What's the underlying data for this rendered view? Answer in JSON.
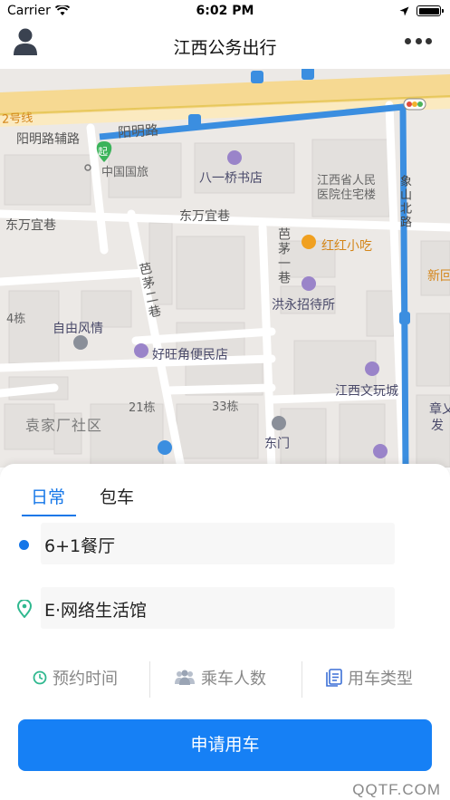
{
  "status_bar": {
    "carrier": "Carrier",
    "time": "6:02 PM"
  },
  "header": {
    "title": "江西公务出行",
    "left_icon": "user-icon",
    "right_icon": "more-icon"
  },
  "map": {
    "labels": {
      "metro_line": "2号线",
      "yangming_fulu": "阳明路辅路",
      "yangming_lu": "阳明路",
      "start_marker": "起",
      "zhongguo_guolv": "中国国旅",
      "bayiqiao_bookstore": "八一桥书店",
      "jiangxi_hospital_line1": "江西省人民",
      "jiangxi_hospital_line2": "医院住宅楼",
      "dongwan_yixiang_left": "东万宜巷",
      "dongwan_yixiang_mid": "东万宜巷",
      "bamao_yixiang": "芭茅一巷",
      "bamao_erxiang": "芭茅二巷",
      "honghong_xiaochi": "红红小吃",
      "xinhua": "新回",
      "hongyong_zhaodaisuo": "洪永招待所",
      "building_4": "4栋",
      "ziyou_fengqing": "自由风情",
      "haowangjiao": "好旺角便民店",
      "jiangxi_wenwancheng": "江西文玩城",
      "building_21": "21栋",
      "building_33": "33栋",
      "zhangjia_line1": "章乂",
      "zhangjia_line2": "发",
      "yuanjiachang": "袁家厂社区",
      "dongmen": "东门",
      "xiangshan_road": "象山北路"
    }
  },
  "panel": {
    "tabs": [
      {
        "label": "日常",
        "active": true
      },
      {
        "label": "包车",
        "active": false
      }
    ],
    "start_location": "6+1餐厅",
    "end_location": "E·网络生活馆",
    "options": [
      {
        "label": "预约时间",
        "icon": "clock-icon"
      },
      {
        "label": "乘车人数",
        "icon": "people-icon"
      },
      {
        "label": "用车类型",
        "icon": "document-icon"
      }
    ],
    "submit_label": "申请用车",
    "watermark": "QQTF.COM"
  },
  "colors": {
    "accent": "#1677e8",
    "button": "#1680f5",
    "route": "#3b8ee0",
    "map_bg": "#ece9e6"
  }
}
